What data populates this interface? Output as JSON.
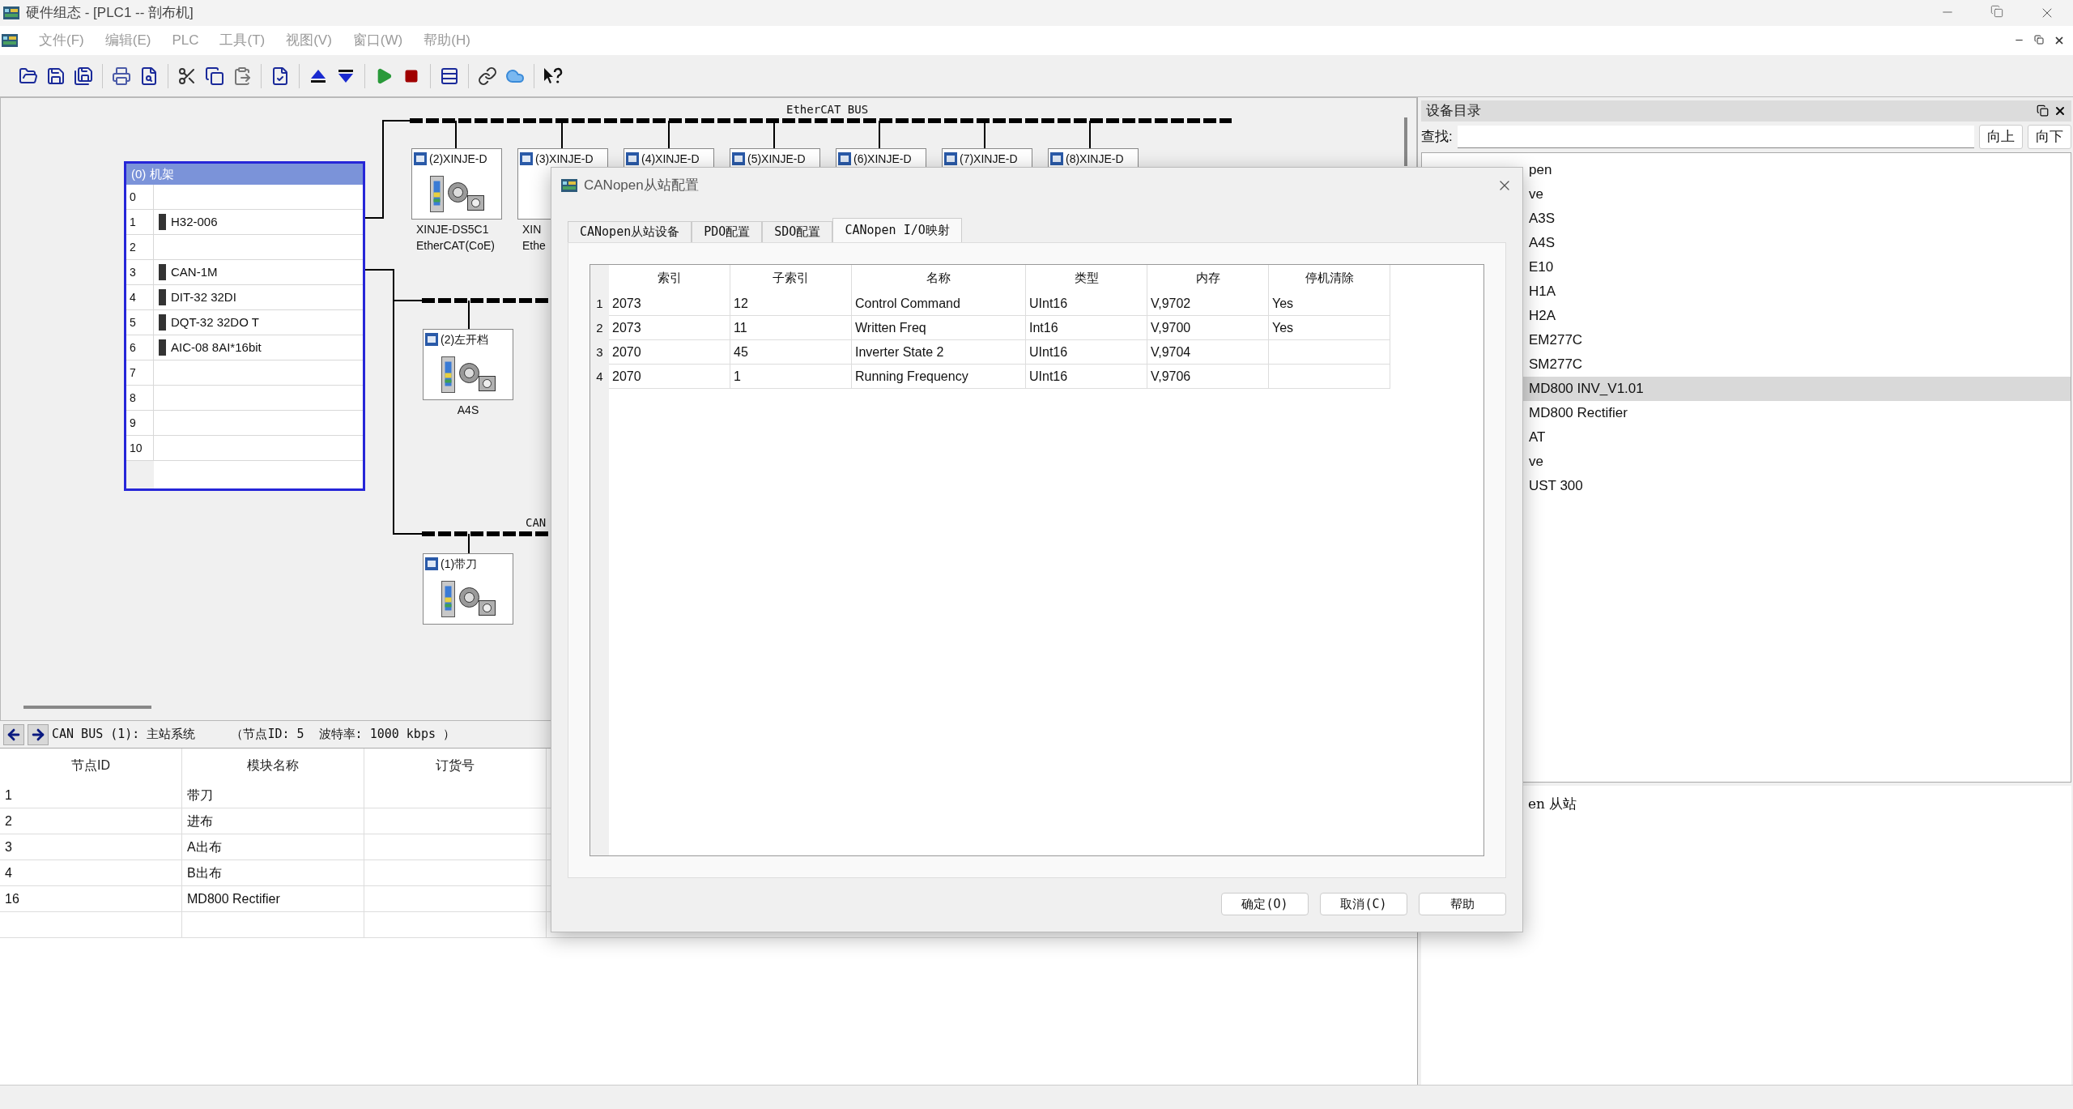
{
  "window": {
    "title": "硬件组态 - [PLC1 -- 剖布机]"
  },
  "menu": [
    {
      "label": "文件(F)",
      "disabled": true
    },
    {
      "label": "编辑(E)",
      "disabled": true
    },
    {
      "label": "PLC",
      "disabled": true
    },
    {
      "label": "工具(T)",
      "disabled": true
    },
    {
      "label": "视图(V)",
      "disabled": true
    },
    {
      "label": "窗口(W)",
      "disabled": true
    },
    {
      "label": "帮助(H)",
      "disabled": true
    }
  ],
  "canvas": {
    "ethercat_bus": {
      "label": "EtherCAT BUS",
      "nodes": [
        {
          "header": "(2)XINJE-D",
          "caption_lines": [
            "XINJE-DS5C1",
            "EtherCAT(CoE)"
          ]
        },
        {
          "header": "(3)XINJE-D",
          "caption_lines": [
            "XIN",
            "Ethe"
          ]
        },
        {
          "header": "(4)XINJE-D"
        },
        {
          "header": "(5)XINJE-D"
        },
        {
          "header": "(6)XINJE-D"
        },
        {
          "header": "(7)XINJE-D"
        },
        {
          "header": "(8)XINJE-D"
        }
      ]
    },
    "rack": {
      "title": "(0) 机架",
      "slots": [
        {
          "slot": "0"
        },
        {
          "slot": "1",
          "module": "H32-006"
        },
        {
          "slot": "2"
        },
        {
          "slot": "3",
          "module": "CAN-1M"
        },
        {
          "slot": "4",
          "module": "DIT-32 32DI"
        },
        {
          "slot": "5",
          "module": "DQT-32 32DO T"
        },
        {
          "slot": "6",
          "module": "AIC-08 8AI*16bit"
        },
        {
          "slot": "7"
        },
        {
          "slot": "8"
        },
        {
          "slot": "9"
        },
        {
          "slot": "10"
        }
      ]
    },
    "middle_bus": {
      "nodes": [
        {
          "header": "(2)左开档",
          "caption_lines": [
            "A4S"
          ]
        }
      ]
    },
    "can_bus": {
      "label": "CAN",
      "nodes": [
        {
          "header": "(1)带刀"
        }
      ]
    }
  },
  "bus_info": {
    "title": "CAN BUS (1): 主站系统",
    "details": "（节点ID: 5  波特率: 1000 kbps ）"
  },
  "node_table": {
    "columns": [
      "节点ID",
      "模块名称",
      "订货号"
    ],
    "rows": [
      {
        "node_id": "1",
        "module": "带刀"
      },
      {
        "node_id": "2",
        "module": "进布"
      },
      {
        "node_id": "3",
        "module": "A出布"
      },
      {
        "node_id": "4",
        "module": "B出布"
      },
      {
        "node_id": "16",
        "module": "MD800 Rectifier"
      }
    ]
  },
  "catalog": {
    "title": "设备目录",
    "search_label": "查找:",
    "buttons": [
      "向上",
      "向下"
    ],
    "items": [
      {
        "label": "pen",
        "selected": false
      },
      {
        "label": "ve",
        "selected": false
      },
      {
        "label": "A3S",
        "selected": false
      },
      {
        "label": "A4S",
        "selected": false
      },
      {
        "label": "E10",
        "selected": false
      },
      {
        "label": "H1A",
        "selected": false
      },
      {
        "label": "H2A",
        "selected": false
      },
      {
        "label": "EM277C",
        "selected": false
      },
      {
        "label": "SM277C",
        "selected": false
      },
      {
        "label": "MD800 INV_V1.01",
        "selected": true
      },
      {
        "label": "MD800 Rectifier",
        "selected": false
      },
      {
        "label": "AT",
        "selected": false
      },
      {
        "label": "ve",
        "selected": false
      },
      {
        "label": "UST 300",
        "selected": false
      }
    ],
    "description": "en 从站"
  },
  "dialog": {
    "title": "CANopen从站配置",
    "tabs": [
      {
        "label": "CANopen从站设备",
        "selected": false
      },
      {
        "label": "PDO配置",
        "selected": false
      },
      {
        "label": "SDO配置",
        "selected": false
      },
      {
        "label": "CANopen I/O映射",
        "selected": true
      }
    ],
    "table": {
      "columns": [
        "索引",
        "子索引",
        "名称",
        "类型",
        "内存",
        "停机清除"
      ],
      "rows": [
        {
          "number": "1",
          "index": "2073",
          "subindex": "12",
          "name": "Control Command",
          "type": "UInt16",
          "memory": "V,9702",
          "clear_on_stop": "Yes"
        },
        {
          "number": "2",
          "index": "2073",
          "subindex": "11",
          "name": "Written Freq",
          "type": "Int16",
          "memory": "V,9700",
          "clear_on_stop": "Yes"
        },
        {
          "number": "3",
          "index": "2070",
          "subindex": "45",
          "name": "Inverter State 2",
          "type": "UInt16",
          "memory": "V,9704"
        },
        {
          "number": "4",
          "index": "2070",
          "subindex": "1",
          "name": "Running Frequency",
          "type": "UInt16",
          "memory": "V,9706"
        }
      ]
    },
    "buttons": [
      "确定(O)",
      "取消(C)",
      "帮助"
    ]
  }
}
